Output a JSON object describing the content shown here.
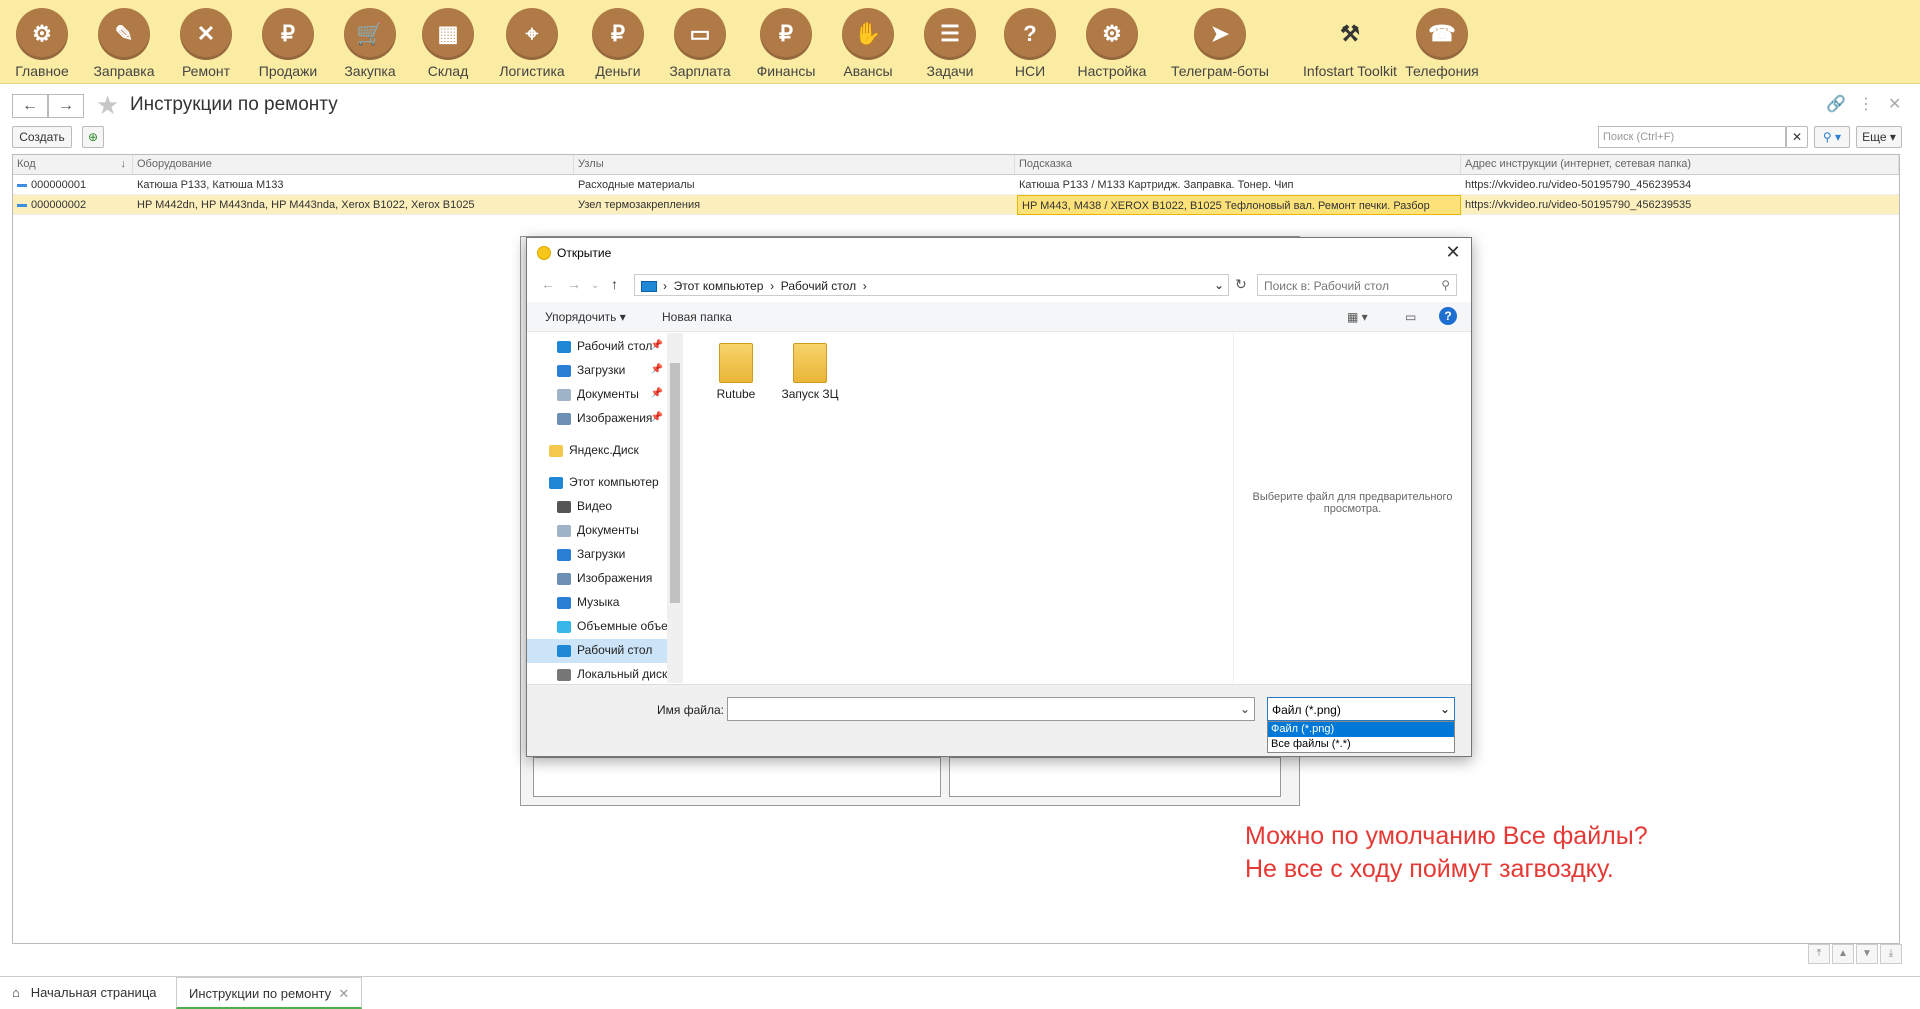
{
  "topbar": {
    "items": [
      {
        "label": "Главное",
        "icon": "gear-cluster-icon",
        "glyph": "⚙"
      },
      {
        "label": "Заправка",
        "icon": "cartridge-refill-icon",
        "glyph": "✎"
      },
      {
        "label": "Ремонт",
        "icon": "wrench-screwdriver-icon",
        "glyph": "✕"
      },
      {
        "label": "Продажи",
        "icon": "sale-tag-icon",
        "glyph": "₽"
      },
      {
        "label": "Закупка",
        "icon": "cart-icon",
        "glyph": "🛒"
      },
      {
        "label": "Склад",
        "icon": "warehouse-icon",
        "glyph": "▦"
      },
      {
        "label": "Логистика",
        "icon": "map-pin-icon",
        "glyph": "⌖"
      },
      {
        "label": "Деньги",
        "icon": "money-bag-icon",
        "glyph": "₽"
      },
      {
        "label": "Зарплата",
        "icon": "wallet-icon",
        "glyph": "▭"
      },
      {
        "label": "Финансы",
        "icon": "briefcase-icon",
        "glyph": "₽"
      },
      {
        "label": "Авансы",
        "icon": "hand-money-icon",
        "glyph": "✋"
      },
      {
        "label": "Задачи",
        "icon": "checklist-icon",
        "glyph": "☰"
      },
      {
        "label": "НСИ",
        "icon": "help-document-icon",
        "glyph": "?"
      },
      {
        "label": "Настройка",
        "icon": "settings-gear-icon",
        "glyph": "⚙"
      },
      {
        "label": "Телеграм-боты",
        "icon": "telegram-icon",
        "glyph": "➤"
      },
      {
        "label": "Infostart Toolkit",
        "icon": "tools-icon",
        "glyph": "⚒"
      },
      {
        "label": "Телефония",
        "icon": "telephone-icon",
        "glyph": "☎"
      }
    ]
  },
  "page": {
    "title": "Инструкции по ремонту"
  },
  "commands": {
    "create": "Создать",
    "search_placeholder": "Поиск (Ctrl+F)",
    "more": "Еще"
  },
  "table": {
    "columns": [
      "Код",
      "Оборудование",
      "Узлы",
      "Подсказка",
      "Адрес инструкции (интернет, сетевая папка)"
    ],
    "rows": [
      {
        "code": "000000001",
        "equipment": "Катюша P133, Катюша M133",
        "nodes": "Расходные материалы",
        "hint": "Катюша P133 / M133 Картридж. Заправка. Тонер. Чип",
        "url": "https://vkvideo.ru/video-50195790_456239534"
      },
      {
        "code": "000000002",
        "equipment": "HP M442dn, HP M443nda, HP M443nda, Xerox B1022, Xerox B1025",
        "nodes": "Узел термозакрепления",
        "hint": "HP M443, M438 / XEROX B1022, B1025 Тефлоновый вал. Ремонт печки. Разбор",
        "url": "https://vkvideo.ru/video-50195790_456239535"
      }
    ]
  },
  "dialog": {
    "title": "Открытие",
    "breadcrumb": [
      "Этот компьютер",
      "Рабочий стол"
    ],
    "search_placeholder": "Поиск в: Рабочий стол",
    "organize": "Упорядочить",
    "new_folder": "Новая папка",
    "tree": [
      {
        "label": "Рабочий стол",
        "icon": "desktop-icon",
        "pinned": true,
        "color": "#1e88d6"
      },
      {
        "label": "Загрузки",
        "icon": "download-arrow-icon",
        "pinned": true,
        "color": "#2a7fd4"
      },
      {
        "label": "Документы",
        "icon": "document-icon",
        "pinned": true,
        "color": "#9fb3c8"
      },
      {
        "label": "Изображения",
        "icon": "image-icon",
        "pinned": true,
        "color": "#6d8fb3"
      },
      {
        "label": "Яндекс.Диск",
        "icon": "folder-icon",
        "pinned": false,
        "color": "#f2c94c"
      },
      {
        "label": "Этот компьютер",
        "icon": "computer-icon",
        "pinned": false,
        "color": "#1e88d6"
      },
      {
        "label": "Видео",
        "icon": "video-icon",
        "pinned": false,
        "color": "#555555"
      },
      {
        "label": "Документы",
        "icon": "document-icon",
        "pinned": false,
        "color": "#9fb3c8"
      },
      {
        "label": "Загрузки",
        "icon": "download-arrow-icon",
        "pinned": false,
        "color": "#2a7fd4"
      },
      {
        "label": "Изображения",
        "icon": "image-icon",
        "pinned": false,
        "color": "#6d8fb3"
      },
      {
        "label": "Музыка",
        "icon": "music-note-icon",
        "pinned": false,
        "color": "#2a7fd4"
      },
      {
        "label": "Объемные объекты",
        "icon": "cube-icon",
        "pinned": false,
        "color": "#37b6e9"
      },
      {
        "label": "Рабочий стол",
        "icon": "desktop-icon",
        "pinned": false,
        "color": "#1e88d6"
      },
      {
        "label": "Локальный диск",
        "icon": "drive-icon",
        "pinned": false,
        "color": "#777777"
      }
    ],
    "files": [
      {
        "label": "Rutube",
        "icon": "folder-icon"
      },
      {
        "label": "Запуск ЗЦ",
        "icon": "folder-icon"
      }
    ],
    "preview_text": "Выберите файл для предварительного просмотра.",
    "filename_label": "Имя файла:",
    "filename_value": "",
    "filetype_selected": "Файл (*.png)",
    "filetype_options": [
      "Файл (*.png)",
      "Все файлы (*.*)"
    ]
  },
  "annotation": {
    "line1": "Можно по умолчанию Все файлы?",
    "line2": "Не все с ходу поймут загвоздку."
  },
  "tabs": {
    "home": "Начальная страница",
    "current": "Инструкции по ремонту"
  }
}
